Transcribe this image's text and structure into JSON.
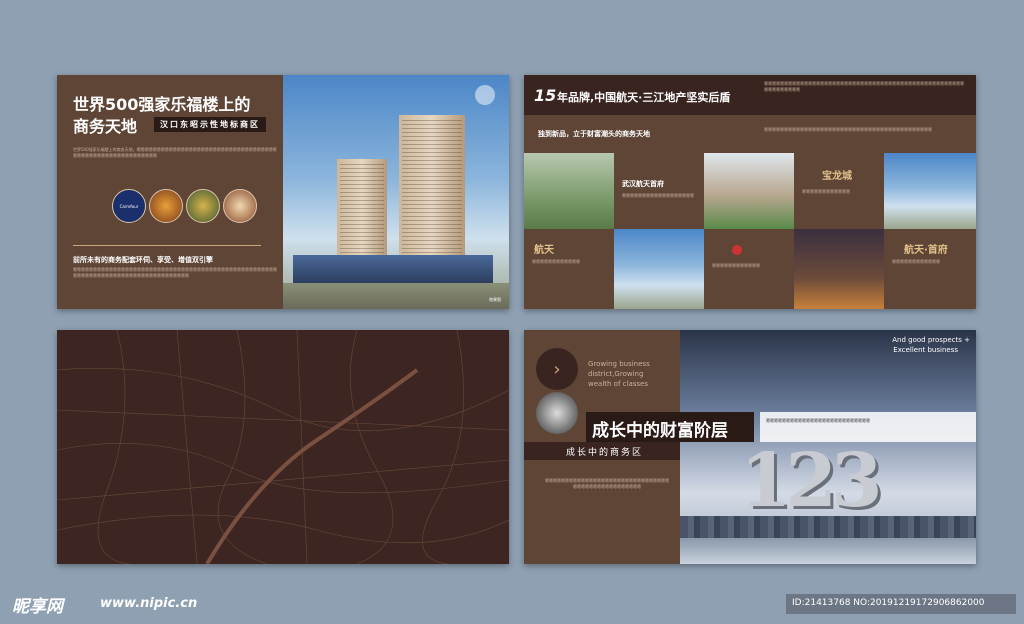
{
  "colors": {
    "page_bg": "#8ea0b2",
    "panel_brown": "#5e4536",
    "panel_dark": "#3d2622",
    "accent_gold": "#c9a47a"
  },
  "panel1": {
    "title_line1": "世界500强家乐福楼上的",
    "title_line2": "商务天地",
    "subtitle_chip": "汉口东昭示性地标商区",
    "body_text": "世界500强家乐福楼上的商务天地，嗯嗯嗯嗯嗯嗯嗯嗯嗯嗯嗯嗯嗯嗯嗯嗯嗯嗯嗯嗯嗯嗯嗯嗯嗯嗯嗯嗯嗯嗯嗯嗯嗯嗯嗯嗯嗯嗯嗯嗯嗯嗯嗯嗯嗯嗯嗯嗯嗯嗯嗯嗯嗯嗯嗯嗯",
    "carrefour_label": "Carrefour",
    "section_heading": "前所未有的商务配套环伺、享受、增值双引擎",
    "section_body": "嗯嗯嗯嗯嗯嗯嗯嗯嗯嗯嗯嗯嗯嗯嗯嗯嗯嗯嗯嗯嗯嗯嗯嗯嗯嗯嗯嗯嗯嗯嗯嗯嗯嗯嗯嗯嗯嗯嗯嗯嗯嗯嗯嗯嗯嗯嗯嗯嗯嗯嗯嗯嗯嗯嗯嗯嗯嗯嗯嗯嗯嗯嗯嗯嗯嗯嗯嗯嗯嗯嗯嗯嗯嗯嗯嗯嗯嗯嗯嗯",
    "photo_caption": "效果图"
  },
  "panel2": {
    "title_num": "15",
    "title": "年品牌,中国航天·三江地产坚实后盾",
    "subheading": "独到新品，立于财富潮头的商务天地",
    "top_text": "嗯嗯嗯嗯嗯嗯嗯嗯嗯嗯嗯嗯嗯嗯嗯嗯嗯嗯嗯嗯嗯嗯嗯嗯嗯嗯嗯嗯嗯嗯嗯嗯嗯嗯嗯嗯嗯嗯嗯嗯嗯嗯嗯嗯嗯嗯嗯嗯嗯嗯嗯嗯嗯嗯嗯嗯嗯嗯嗯",
    "right_text": "嗯嗯嗯嗯嗯嗯嗯嗯嗯嗯嗯嗯嗯嗯嗯嗯嗯嗯嗯嗯嗯嗯嗯嗯嗯嗯嗯嗯嗯嗯嗯嗯嗯嗯嗯嗯嗯嗯嗯嗯嗯嗯",
    "project_label": "武汉航天首府",
    "project_text": "嗯嗯嗯嗯嗯嗯嗯嗯嗯嗯嗯嗯嗯嗯嗯嗯嗯嗯",
    "logo_left": "航天",
    "logo_center": "宝龙城",
    "logo_right": "航天·首府",
    "cell_text": "嗯嗯嗯嗯嗯嗯嗯嗯嗯嗯嗯嗯"
  },
  "panel4": {
    "english_lines": [
      "Growing business",
      "district,Growing",
      "wealth of classes"
    ],
    "top_right_english": [
      "And good prospects +",
      "Excellent business"
    ],
    "headline": "成长中的财富阶层",
    "subline": "成长中的商务区",
    "body_text": "嗯嗯嗯嗯嗯嗯嗯嗯嗯嗯嗯嗯嗯嗯嗯嗯嗯嗯嗯嗯嗯嗯嗯嗯嗯嗯嗯嗯嗯嗯嗯嗯嗯嗯嗯嗯嗯嗯嗯嗯嗯嗯嗯嗯嗯嗯嗯嗯",
    "card_text": "嗯嗯嗯嗯嗯嗯嗯嗯嗯嗯嗯嗯嗯嗯嗯嗯嗯嗯嗯嗯嗯嗯嗯嗯嗯嗯",
    "big_numbers": "123"
  },
  "watermark": {
    "logo_text": "昵享网",
    "url": "www.nipic.cn",
    "id_text": "ID:21413768 NO:20191219172906862000"
  }
}
